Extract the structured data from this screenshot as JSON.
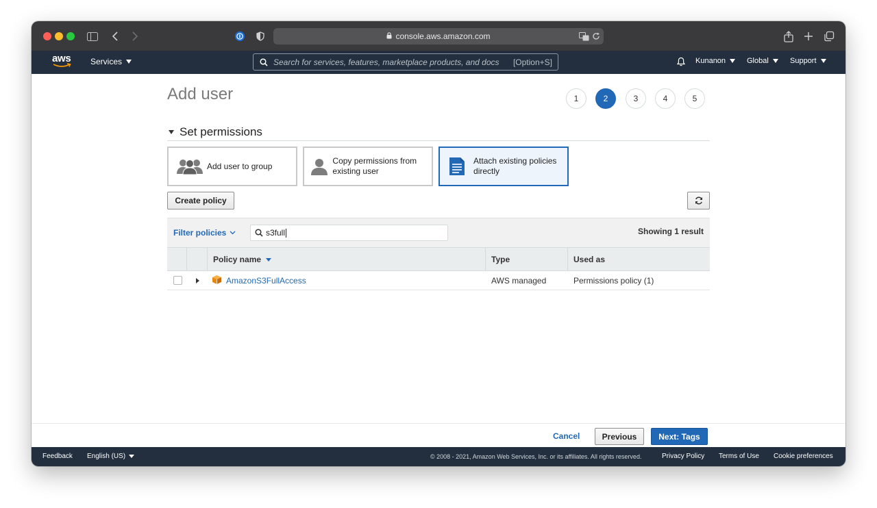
{
  "browser": {
    "url": "console.aws.amazon.com"
  },
  "aws_nav": {
    "logo_text": "aws",
    "services_label": "Services",
    "search_placeholder": "Search for services, features, marketplace products, and docs",
    "search_shortcut": "[Option+S]",
    "account_label": "Kunanon",
    "region_label": "Global",
    "support_label": "Support"
  },
  "page": {
    "title": "Add user",
    "steps": [
      "1",
      "2",
      "3",
      "4",
      "5"
    ],
    "active_step": "2"
  },
  "permissions": {
    "section_title": "Set permissions",
    "options": [
      {
        "label": "Add user to group",
        "icon": "group-icon",
        "selected": false
      },
      {
        "label": "Copy permissions from existing user",
        "icon": "user-icon",
        "selected": false
      },
      {
        "label": "Attach existing policies directly",
        "icon": "document-icon",
        "selected": true
      }
    ],
    "create_policy_label": "Create policy",
    "refresh_icon": "refresh-icon"
  },
  "filter": {
    "label": "Filter policies",
    "search_value": "s3full",
    "result_text": "Showing 1 result"
  },
  "table": {
    "columns": [
      "Policy name",
      "Type",
      "Used as"
    ],
    "rows": [
      {
        "name": "AmazonS3FullAccess",
        "type": "AWS managed",
        "used_as": "Permissions policy (1)"
      }
    ]
  },
  "actions": {
    "cancel": "Cancel",
    "previous": "Previous",
    "next": "Next: Tags"
  },
  "footer": {
    "feedback": "Feedback",
    "language": "English (US)",
    "copyright": "© 2008 - 2021, Amazon Web Services, Inc. or its affiliates. All rights reserved.",
    "privacy": "Privacy Policy",
    "terms": "Terms of Use",
    "cookies": "Cookie preferences"
  },
  "colors": {
    "aws_nav_bg": "#232f3e",
    "primary_blue": "#2169b6",
    "aws_orange": "#ff9900"
  }
}
